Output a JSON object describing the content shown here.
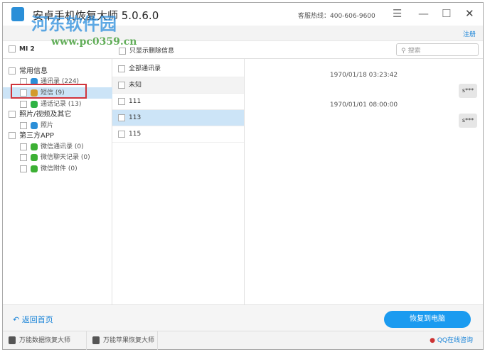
{
  "window": {
    "title": "安卓手机恢复大师 5.0.6.0",
    "hotline": "客服热线：400-606-9600",
    "register": "注册"
  },
  "watermark": {
    "name": "河东软件园",
    "url": "www.pc0359.cn"
  },
  "toolbar": {
    "device": "MI 2",
    "only_deleted": "只显示删除信息",
    "search_placeholder": "搜索"
  },
  "tree": [
    {
      "label": "常用信息",
      "level": 0
    },
    {
      "label": "通讯录 (224)",
      "level": 1,
      "icon": "contacts-icon",
      "color": "#2b8fd8"
    },
    {
      "label": "短信 (9)",
      "level": 1,
      "icon": "sms-icon",
      "color": "#d39a2c",
      "selected": true
    },
    {
      "label": "通话记录 (13)",
      "level": 1,
      "icon": "phone-icon",
      "color": "#2fb344"
    },
    {
      "label": "照片/视频及其它",
      "level": 0
    },
    {
      "label": "照片",
      "level": 1,
      "icon": "photo-icon",
      "color": "#2b8fd8"
    },
    {
      "label": "第三方APP",
      "level": 0
    },
    {
      "label": "微信通讯录 (0)",
      "level": 1,
      "icon": "wechat-icon",
      "color": "#3cb034"
    },
    {
      "label": "微信聊天记录 (0)",
      "level": 1,
      "icon": "wechat-icon",
      "color": "#3cb034"
    },
    {
      "label": "微信附件 (0)",
      "level": 1,
      "icon": "wechat-icon",
      "color": "#3cb034"
    }
  ],
  "contacts": [
    {
      "label": "全部通讯录"
    },
    {
      "label": "未知"
    },
    {
      "label": "111"
    },
    {
      "label": "113",
      "selected": true
    },
    {
      "label": "115"
    }
  ],
  "messages": [
    {
      "time": "1970/01/18 03:23:42",
      "text": "s***"
    },
    {
      "time": "1970/01/01 08:00:00",
      "text": "s***"
    }
  ],
  "bottom": {
    "back": "返回首页",
    "restore": "恢复到电脑"
  },
  "footer": {
    "item1": "万能数据恢复大师",
    "item2": "万能苹果恢复大师",
    "qq": "QQ在线咨询"
  }
}
